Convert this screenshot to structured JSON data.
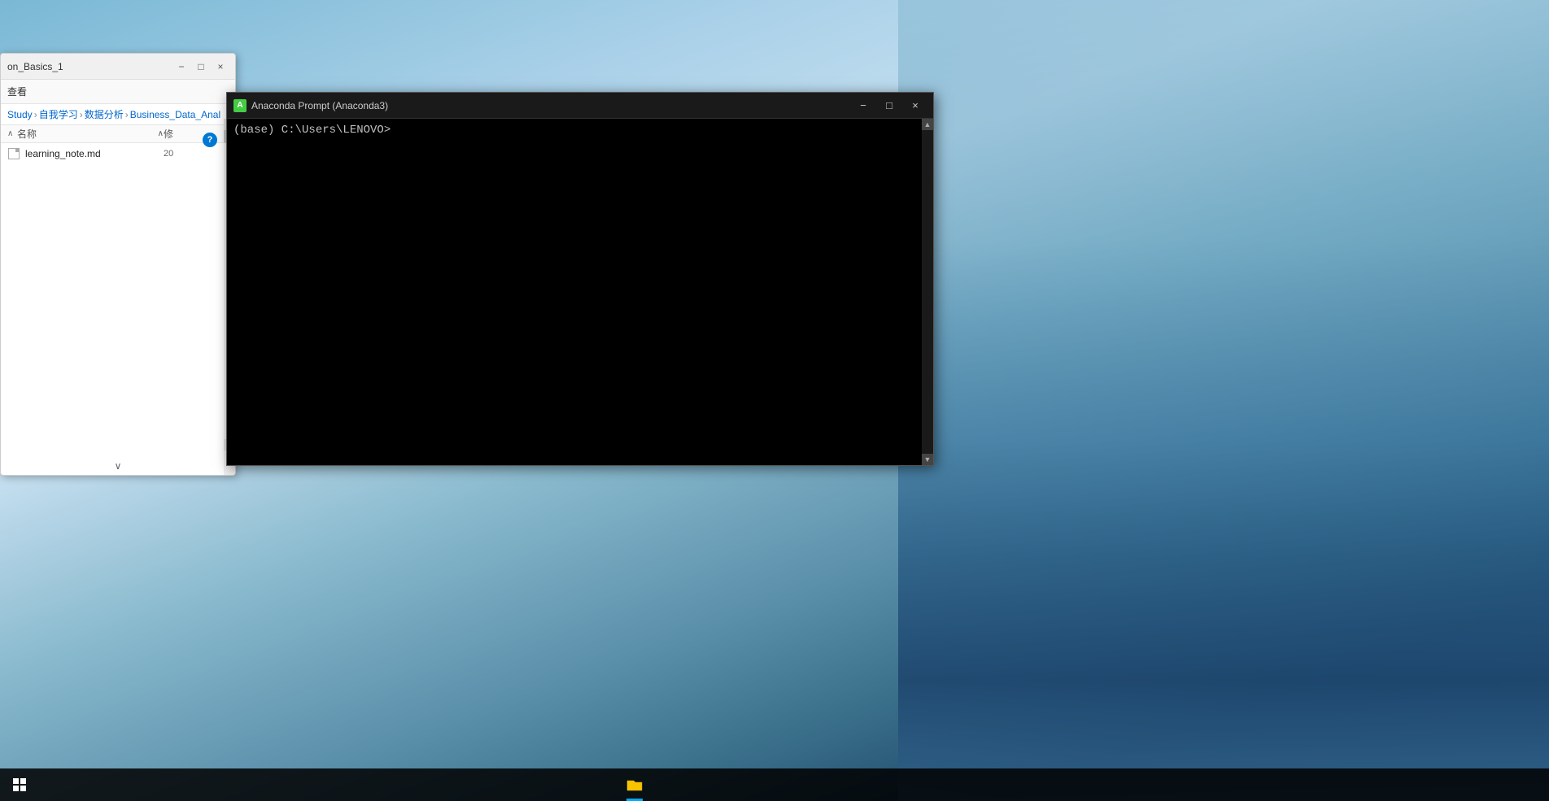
{
  "desktop": {
    "background_description": "Sky and bridge scenery"
  },
  "file_explorer": {
    "title": "on_Basics_1",
    "toolbar": {
      "items": [
        "查看"
      ]
    },
    "breadcrumb": {
      "parts": [
        "Study",
        "自我学习",
        "数据分析",
        "Business_Data_Anal"
      ]
    },
    "column_headers": {
      "name": "名称",
      "sort_arrow": "∧",
      "date": "修"
    },
    "files": [
      {
        "name": "learning_note.md",
        "date": "20"
      }
    ],
    "scroll_arrows": {
      "up": "∧",
      "down": "∨"
    },
    "nav_up_arrow": "∧",
    "nav_down_arrow": "∨"
  },
  "anaconda_prompt": {
    "title": "Anaconda Prompt (Anaconda3)",
    "icon_label": "A",
    "prompt_text": "(base) C:\\Users\\LENOVO>",
    "titlebar_buttons": {
      "minimize": "−",
      "maximize": "□",
      "close": "×"
    },
    "scrollbar": {
      "up_arrow": "▲",
      "down_arrow": "▼"
    }
  },
  "taskbar": {
    "search_placeholder": "",
    "app_icons": []
  }
}
